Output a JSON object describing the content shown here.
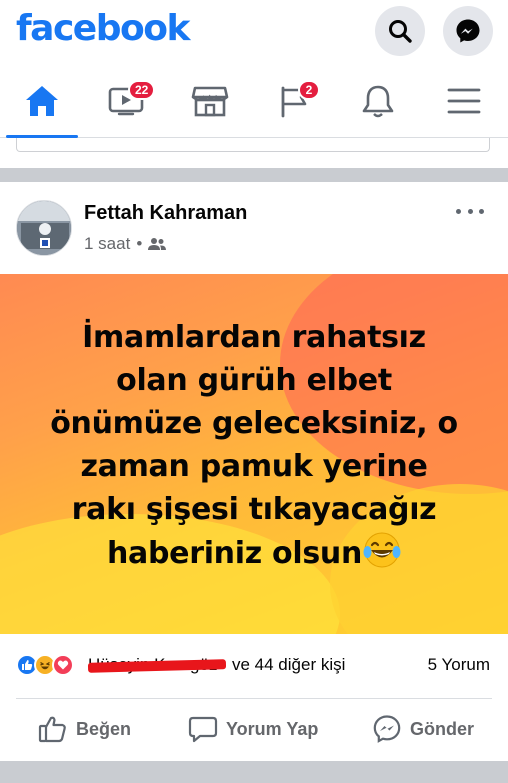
{
  "header": {
    "logo": "facebook",
    "icons": {
      "search": "search-icon",
      "messenger": "messenger-icon"
    }
  },
  "nav": {
    "items": [
      {
        "name": "home",
        "icon": "home-icon",
        "active": true
      },
      {
        "name": "watch",
        "icon": "video-icon",
        "badge": "22"
      },
      {
        "name": "marketplace",
        "icon": "shop-icon"
      },
      {
        "name": "pages",
        "icon": "flag-icon",
        "badge": "2"
      },
      {
        "name": "notifications",
        "icon": "bell-icon"
      },
      {
        "name": "menu",
        "icon": "hamburger-icon"
      }
    ]
  },
  "post": {
    "author": "Fettah Kahraman",
    "time": "1 saat",
    "audience_icon": "friends-icon",
    "text_lines": [
      "İmamlardan rahatsız",
      "olan gürüh elbet",
      "önümüze geleceksiniz, o",
      "zaman pamuk yerine",
      "rakı şişesi tıkayacağız",
      "haberiniz olsun"
    ],
    "emoji": "laughing-tears-emoji",
    "reactions": {
      "icons": [
        "like",
        "haha",
        "love"
      ],
      "first_reactor": "Hüseyin Karagöz",
      "others": "ve 44 diğer kişi",
      "comments": "5 Yorum"
    },
    "actions": {
      "like": "Beğen",
      "comment": "Yorum Yap",
      "send": "Gönder"
    }
  },
  "colors": {
    "brand": "#1877f2",
    "badge": "#e41e3f",
    "muted": "#65676b",
    "separator": "#c9ccd1"
  }
}
